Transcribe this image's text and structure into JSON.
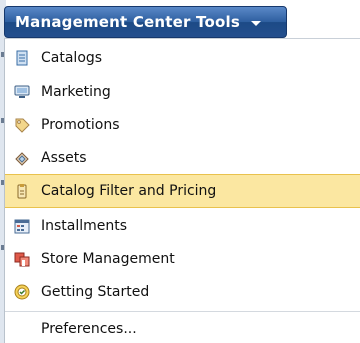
{
  "menu_button": {
    "label": "Management Center Tools"
  },
  "menu": {
    "items": [
      {
        "label": "Catalogs",
        "icon": "catalog-icon"
      },
      {
        "label": "Marketing",
        "icon": "marketing-icon"
      },
      {
        "label": "Promotions",
        "icon": "promotions-tag-icon"
      },
      {
        "label": "Assets",
        "icon": "assets-icon"
      },
      {
        "label": "Catalog Filter and Pricing",
        "icon": "catalog-filter-pricing-icon",
        "highlighted": true
      },
      {
        "label": "Installments",
        "icon": "installments-icon"
      },
      {
        "label": "Store Management",
        "icon": "store-management-icon"
      },
      {
        "label": "Getting Started",
        "icon": "getting-started-icon"
      }
    ],
    "preferences_label": "Preferences..."
  },
  "colors": {
    "button_blue": "#2d5e9f",
    "highlight": "#fbe7a1",
    "highlight_border": "#e9c24d"
  }
}
